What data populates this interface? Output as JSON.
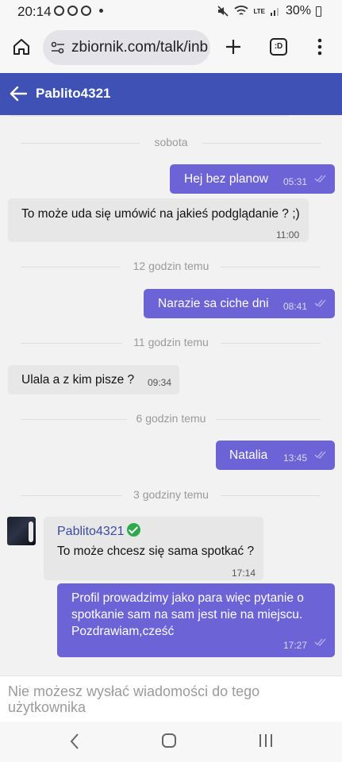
{
  "status": {
    "time": "20:14",
    "battery": "30%",
    "net_label": "LTE"
  },
  "browser": {
    "url": "zbiornik.com/talk/inb",
    "tabs_label": ":D"
  },
  "header": {
    "title": "Pablito4321"
  },
  "chat": {
    "separators": [
      "sobota",
      "12 godzin temu",
      "11 godzin temu",
      "6 godzin temu",
      "3 godziny temu"
    ],
    "messages": [
      {
        "text": "Hej bez planow",
        "time": "05:31"
      },
      {
        "text": "To może uda się umówić na jakieś podglądanie ? ;)",
        "time": "11:00"
      },
      {
        "text": "Narazie sa ciche dni",
        "time": "08:41"
      },
      {
        "text": "Ulala a z kim pisze ?",
        "time": "09:34"
      },
      {
        "text": "Natalia",
        "time": "13:45"
      },
      {
        "sender": "Pablito4321",
        "text": "To może chcesz się sama spotkać ?",
        "time": "17:14"
      },
      {
        "text": "Profil prowadzimy jako para więc pytanie o spotkanie sam na sam jest nie na miejscu. Pozdrawiam,cześć",
        "time": "17:27"
      }
    ]
  },
  "footer": {
    "notice": "Nie możesz wysłać wiadomości do tego użytkownika"
  },
  "colors": {
    "header": "#3f51b5",
    "outgoing": "#6c63d6",
    "incoming": "#e7e7e7",
    "verified": "#2eaa4e"
  }
}
